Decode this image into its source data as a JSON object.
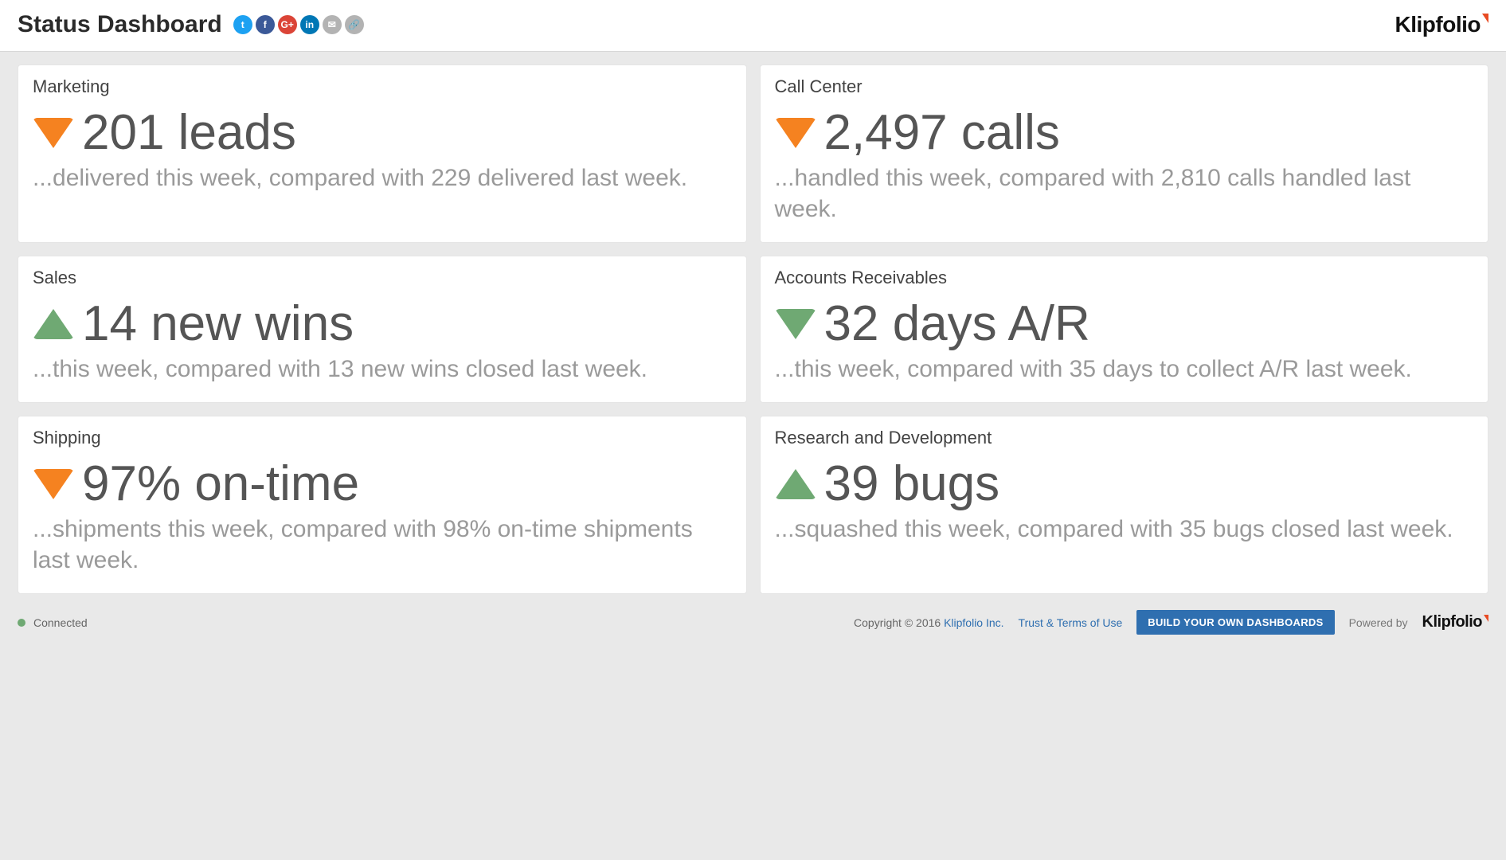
{
  "header": {
    "title": "Status Dashboard",
    "brand": "Klipfolio",
    "share": {
      "twitter_glyph": "t",
      "facebook_glyph": "f",
      "google_glyph": "G+",
      "linkedin_glyph": "in",
      "mail_glyph": "✉",
      "link_glyph": "🔗"
    }
  },
  "cards": [
    {
      "title": "Marketing",
      "trend": "down",
      "trend_color": "orange",
      "metric": "201 leads",
      "subtext": "...delivered this week, compared with 229 delivered last week."
    },
    {
      "title": "Call Center",
      "trend": "down",
      "trend_color": "orange",
      "metric": "2,497 calls",
      "subtext": "...handled this week, compared with 2,810 calls handled last week."
    },
    {
      "title": "Sales",
      "trend": "up",
      "trend_color": "green",
      "metric": "14 new wins",
      "subtext": "...this week, compared with 13 new wins closed last week."
    },
    {
      "title": "Accounts Receivables",
      "trend": "down",
      "trend_color": "green",
      "metric": "32 days A/R",
      "subtext": "...this week, compared with 35 days to collect A/R last week."
    },
    {
      "title": "Shipping",
      "trend": "down",
      "trend_color": "orange",
      "metric": "97% on-time",
      "subtext": "...shipments this week, compared with 98% on-time shipments last week."
    },
    {
      "title": "Research and Development",
      "trend": "up",
      "trend_color": "green",
      "metric": "39 bugs",
      "subtext": "...squashed this week, compared with 35 bugs closed last week."
    }
  ],
  "footer": {
    "status": "Connected",
    "copyright": "Copyright © 2016 ",
    "org_link": "Klipfolio Inc.",
    "terms_link": "Trust & Terms of Use",
    "cta": "BUILD YOUR OWN DASHBOARDS",
    "powered_by": "Powered by",
    "brand": "Klipfolio"
  },
  "colors": {
    "orange": "#f58220",
    "green": "#6fa973",
    "link_blue": "#2f6fb0"
  }
}
